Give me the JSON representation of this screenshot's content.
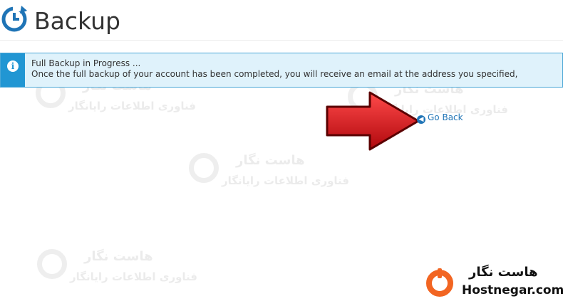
{
  "page": {
    "title": "Backup"
  },
  "alert": {
    "icon": "info-icon",
    "title": "Full Backup in Progress ...",
    "message": "Once the full backup of your account has been completed, you will receive an email at the address you specified, "
  },
  "actions": {
    "go_back_label": "Go Back"
  },
  "watermark": {
    "fa_title": "هاست نگار",
    "fa_subtitle": "فناوری اطلاعات رایانگار"
  },
  "logo": {
    "fa_name": "هاست نگار",
    "domain": "Hostnegar.com"
  },
  "colors": {
    "accent": "#2196d3",
    "link": "#1f74b6",
    "arrow": "#d0161c",
    "logo": "#f26522"
  }
}
